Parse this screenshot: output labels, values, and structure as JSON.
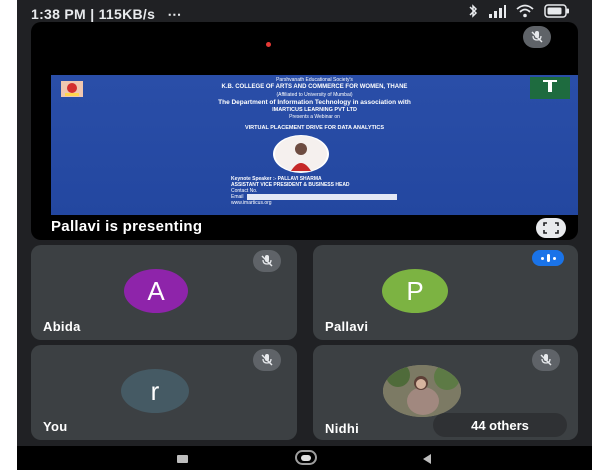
{
  "status_bar": {
    "time_speed": "1:38 PM | 115KB/s",
    "extras": "⋯"
  },
  "presentation": {
    "presenter_label": "Pallavi is presenting",
    "slide": {
      "society": "Parshvanath Educational Society's",
      "college": "K.B. COLLEGE OF ARTS AND COMMERCE FOR WOMEN, THANE",
      "affiliation": "(Affiliated to University of Mumbai)",
      "dept_line": "The Department of Information Technology in association with",
      "partner": "IMARTICUS LEARNING PVT LTD",
      "presents": "Presents a Webinar on",
      "topic": "VIRTUAL PLACEMENT DRIVE FOR DATA ANALYTICS",
      "speaker": "Keynote Speaker :- PALLAVI SHARMA",
      "role": "ASSISTANT VICE PRESIDENT & BUSINESS HEAD",
      "contact": "Contact No.",
      "email": "Email",
      "web": "www.imarticus.org",
      "partner_logo_text": "IMARTICUS"
    }
  },
  "participants": [
    {
      "name": "Abida",
      "initial": "A",
      "color": "#8e24aa"
    },
    {
      "name": "Pallavi",
      "initial": "P",
      "color": "#7cb342"
    },
    {
      "name": "You",
      "initial": "r",
      "color": "#455a64"
    },
    {
      "name": "Nidhi",
      "initial": "",
      "color": "#6d6a5a"
    }
  ],
  "others_badge": "44 others",
  "colors": {
    "background": "#202124",
    "tile": "#3c4043",
    "slide_blue": "#2a4ea8",
    "speaking_indicator": "#1a73e8"
  }
}
